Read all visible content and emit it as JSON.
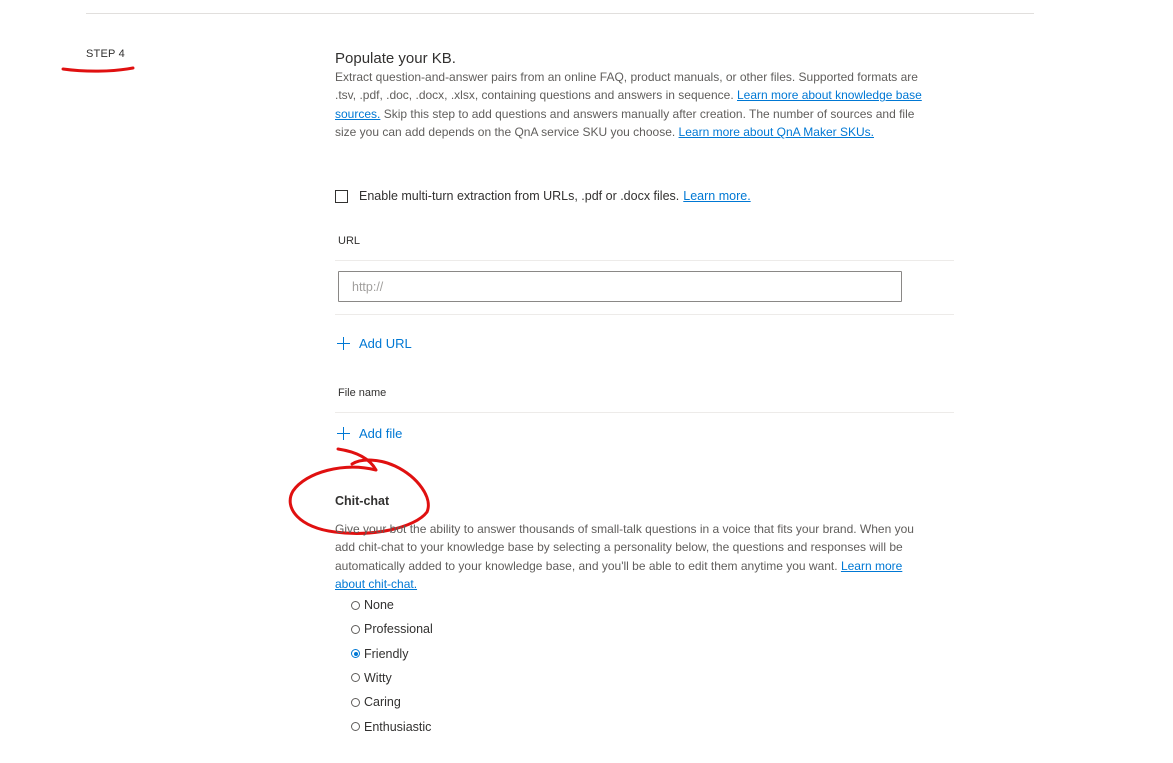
{
  "step": {
    "label": "STEP 4"
  },
  "populate": {
    "title": "Populate your KB.",
    "desc_part1": "Extract question-and-answer pairs from an online FAQ, product manuals, or other files. Supported formats are .tsv, .pdf, .doc, .docx, .xlsx, containing questions and answers in sequence. ",
    "link_sources": "Learn more about knowledge base sources.",
    "desc_part2": " Skip this step to add questions and answers manually after creation. The number of sources and file size you can add depends on the QnA service SKU you choose. ",
    "link_skus": "Learn more about QnA Maker SKUs."
  },
  "multiturn": {
    "label": "Enable multi-turn extraction from URLs, .pdf or .docx files.",
    "link": "Learn more.",
    "checked": false
  },
  "url_section": {
    "header": "URL",
    "placeholder": "http://",
    "value": "",
    "add_label": "Add URL"
  },
  "file_section": {
    "header": "File name",
    "add_label": "Add file"
  },
  "chitchat": {
    "title": "Chit-chat",
    "desc": "Give your bot the ability to answer thousands of small-talk questions in a voice that fits your brand. When you add chit-chat to your knowledge base by selecting a personality below, the questions and responses will be automatically added to your knowledge base, and you'll be able to edit them anytime you want. ",
    "link": "Learn more about chit-chat.",
    "options": [
      "None",
      "Professional",
      "Friendly",
      "Witty",
      "Caring",
      "Enthusiastic"
    ],
    "selected": "Friendly"
  },
  "colors": {
    "accent": "#0078d4",
    "annotation": "#e01010"
  }
}
